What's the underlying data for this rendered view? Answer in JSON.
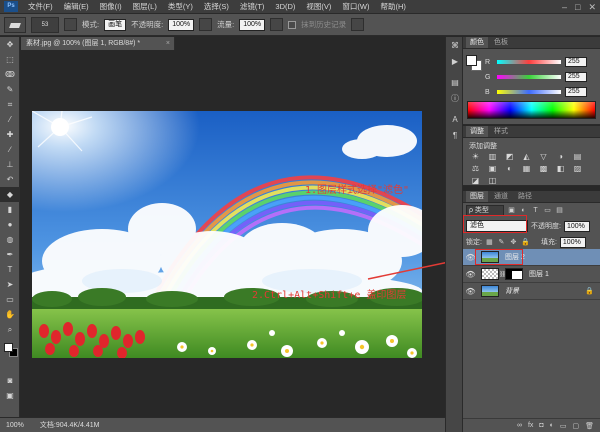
{
  "menu": {
    "logo": "Ps",
    "items": [
      "文件(F)",
      "编辑(E)",
      "图像(I)",
      "图层(L)",
      "类型(Y)",
      "选择(S)",
      "滤镜(T)",
      "3D(D)",
      "视图(V)",
      "窗口(W)",
      "帮助(H)"
    ],
    "window_controls": [
      "–",
      "□",
      "✕"
    ]
  },
  "options_bar": {
    "brush_size": "53",
    "mode_label": "模式:",
    "mode_value": "画笔",
    "opacity_label": "不透明度:",
    "opacity_value": "100%",
    "flow_label": "流量:",
    "flow_value": "100%",
    "history_label": "抹到历史记录"
  },
  "document": {
    "tab_title": "素材.jpg @ 100% (图层 1, RGB/8#) *",
    "close": "×"
  },
  "status_bar": {
    "zoom": "100%",
    "doc_info": "文档:904.4K/4.41M"
  },
  "annotations": {
    "step1": "1.图层样式选择\"滤色\"",
    "step2": "2.Ctrl+Alt+Shift+e 盖印图层"
  },
  "color_panel": {
    "tabs": [
      "颜色",
      "色板"
    ],
    "channels": [
      {
        "name": "R",
        "value": "255"
      },
      {
        "name": "G",
        "value": "255"
      },
      {
        "name": "B",
        "value": "255"
      }
    ],
    "colors": {
      "r": "#ff3d3d",
      "g": "#38d338",
      "b": "#3d6bff"
    }
  },
  "adjustments_panel": {
    "tabs": [
      "调整",
      "样式"
    ],
    "title": "添加调整",
    "icons": [
      "☀",
      "▥",
      "◩",
      "◭",
      "▽",
      "◑",
      "▤",
      "⚖",
      "▣",
      "◐",
      "▦",
      "▩",
      "◧",
      "▨",
      "◪",
      "◫"
    ]
  },
  "layers_panel": {
    "tabs": [
      "图层",
      "通道",
      "路径"
    ],
    "filter_label": "ρ 类型",
    "blend_mode": "滤色",
    "opacity_label": "不透明度:",
    "opacity_value": "100%",
    "lock_label": "锁定:",
    "fill_label": "填充:",
    "fill_value": "100%",
    "layers": [
      {
        "name": "图层 2",
        "selected": true
      },
      {
        "name": "图层 1",
        "selected": false
      },
      {
        "name": "背景",
        "selected": false
      }
    ],
    "footer_icons": [
      "∞",
      "fx",
      "◘",
      "◐",
      "▭",
      "▢",
      "🗑"
    ]
  }
}
